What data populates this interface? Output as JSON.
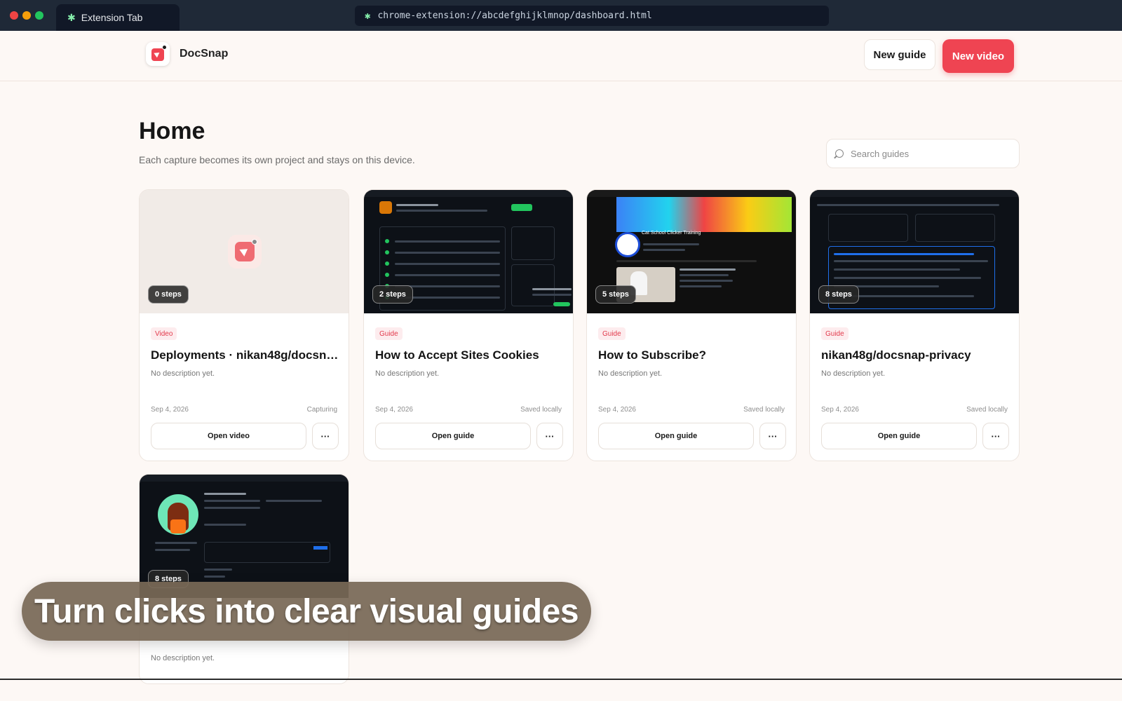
{
  "browser": {
    "tab_title": "Extension Tab",
    "url": "chrome-extension://abcdefghijklmnop/dashboard.html"
  },
  "app": {
    "name": "DocSnap",
    "new_guide_label": "New guide",
    "new_video_label": "New video",
    "accent_color": "#ef4452"
  },
  "page": {
    "title": "Home",
    "subtitle": "Each capture becomes its own project and stays on this device.",
    "search_placeholder": "Search guides"
  },
  "cards": [
    {
      "steps": "0 steps",
      "type": "Video",
      "title": "Deployments · nikan48g/docsna...",
      "description": "No description yet.",
      "date": "Sep 4, 2026",
      "status": "Capturing",
      "action": "Open video",
      "more": "···"
    },
    {
      "steps": "2 steps",
      "type": "Guide",
      "title": "How to Accept Sites Cookies",
      "description": "No description yet.",
      "date": "Sep 4, 2026",
      "status": "Saved locally",
      "action": "Open guide",
      "more": "···"
    },
    {
      "steps": "5 steps",
      "type": "Guide",
      "title": "How to Subscribe?",
      "description": "No description yet.",
      "date": "Sep 4, 2026",
      "status": "Saved locally",
      "action": "Open guide",
      "more": "···",
      "thumb_text": "Cat School Clicker Training"
    },
    {
      "steps": "8 steps",
      "type": "Guide",
      "title": "nikan48g/docsnap-privacy",
      "description": "No description yet.",
      "date": "Sep 4, 2026",
      "status": "Saved locally",
      "action": "Open guide",
      "more": "···"
    },
    {
      "steps": "8 steps",
      "description": "No description yet."
    }
  ],
  "caption": "Turn clicks into clear visual guides"
}
